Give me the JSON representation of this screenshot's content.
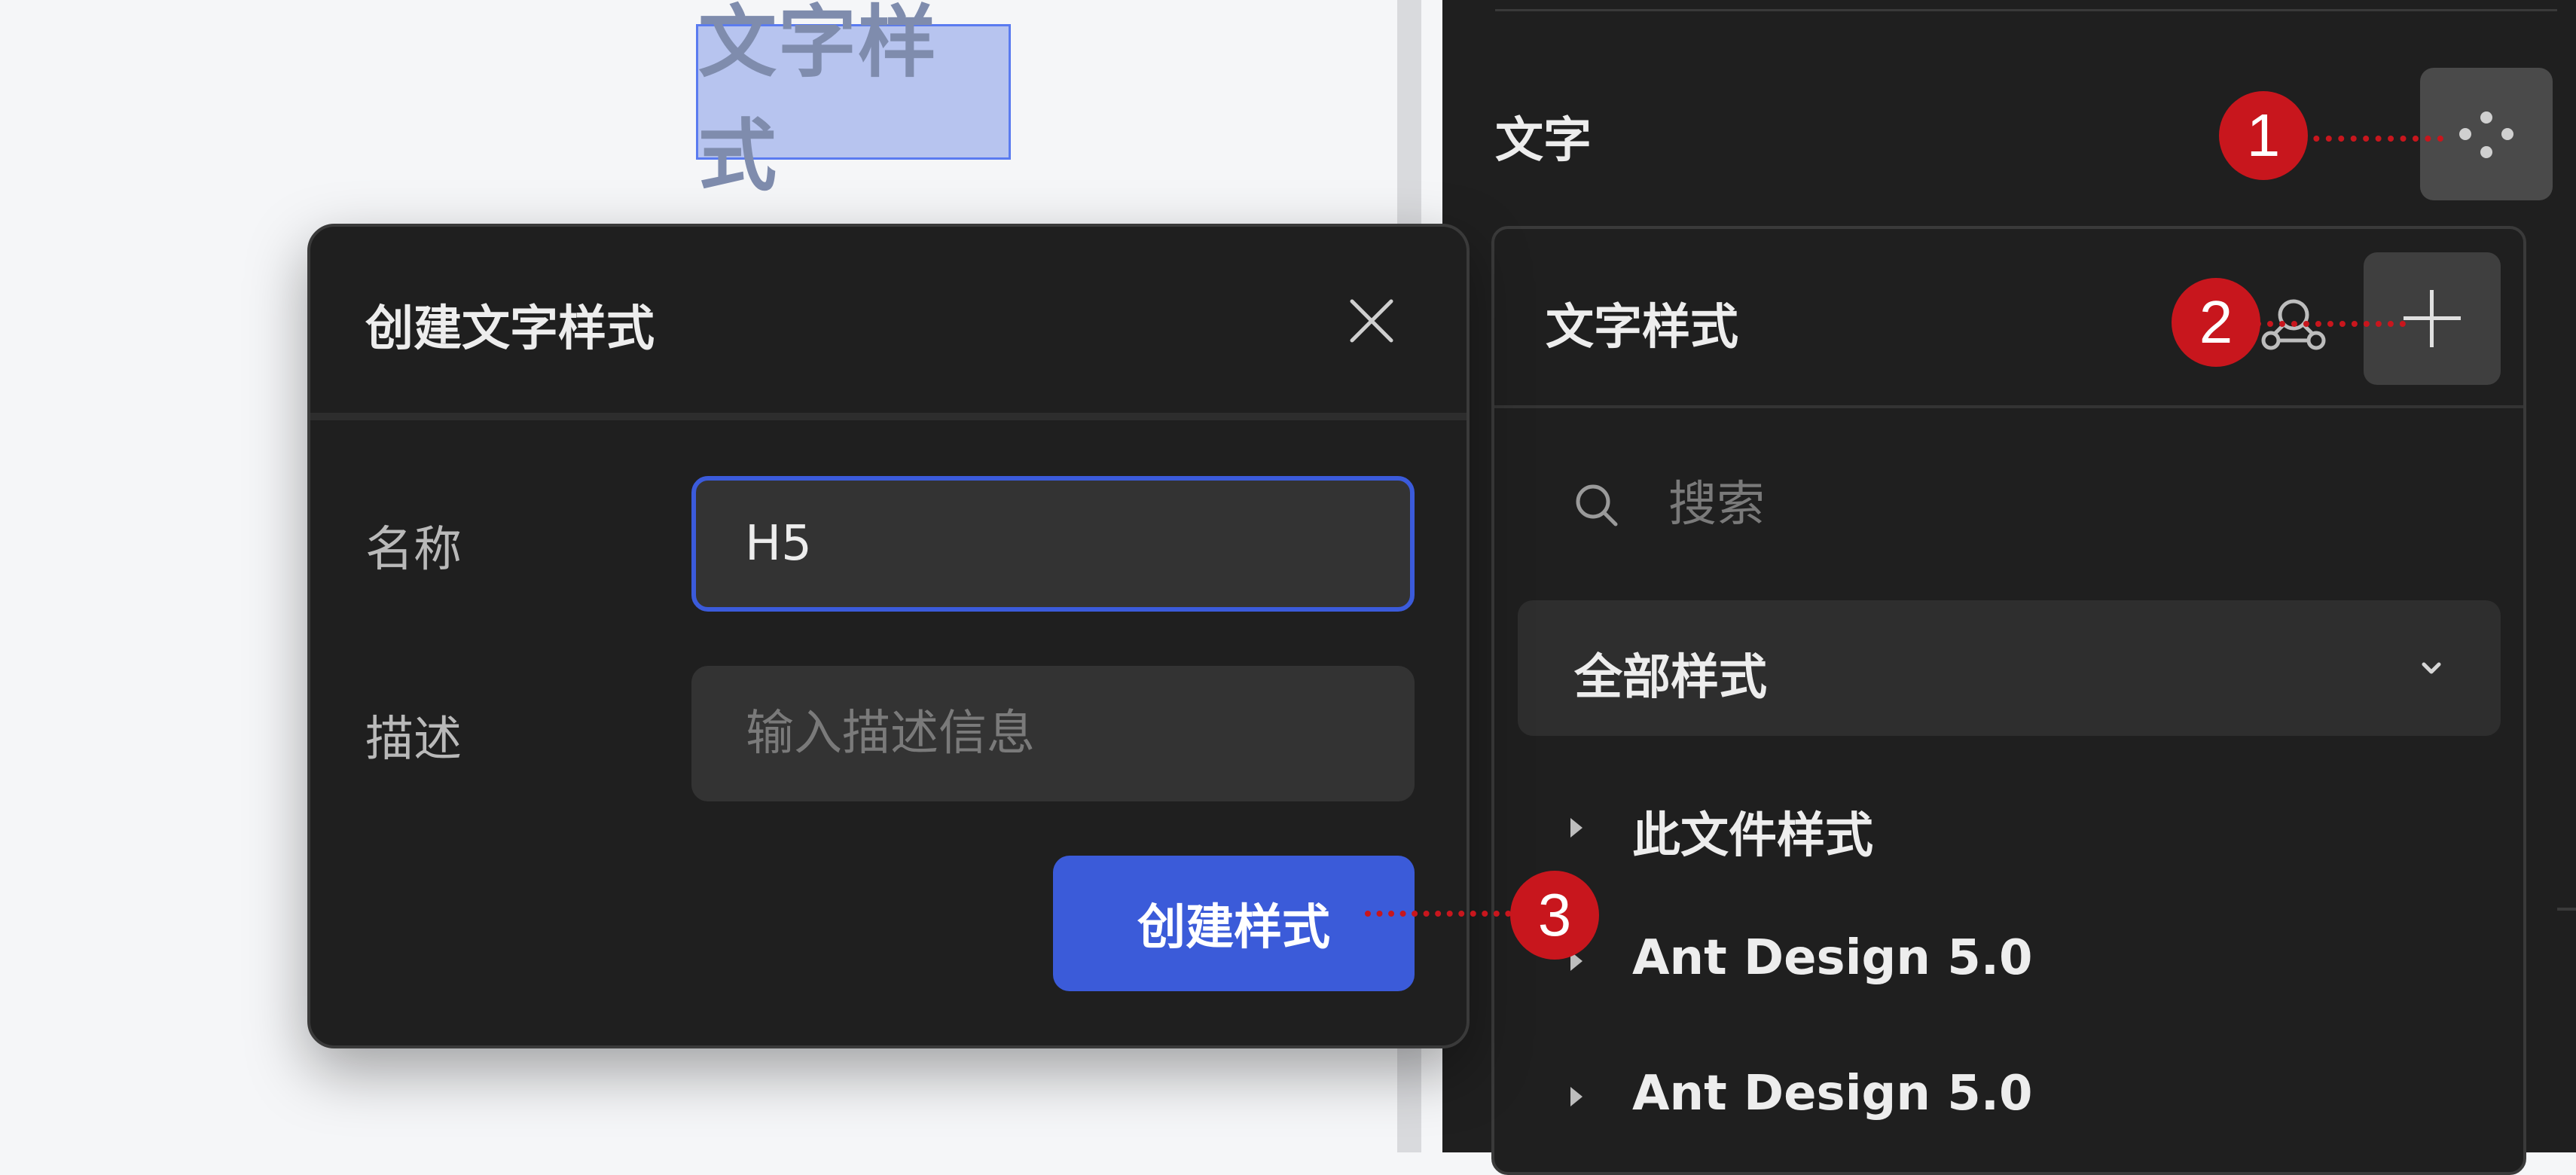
{
  "canvas": {
    "selected_text": "文字样式"
  },
  "panel": {
    "section_title": "文字",
    "style_icon": "four-dots-style-icon"
  },
  "styles_panel": {
    "title": "文字样式",
    "publish_icon": "team-library-icon",
    "add_icon": "plus-icon",
    "search": {
      "placeholder": "搜索",
      "value": ""
    },
    "filter": {
      "selected": "全部样式"
    },
    "groups": [
      {
        "label": "此文件样式"
      },
      {
        "label": "Ant Design 5.0"
      },
      {
        "label": "Ant Design 5.0"
      }
    ]
  },
  "modal": {
    "title": "创建文字样式",
    "close_icon": "close-icon",
    "name_label": "名称",
    "name_value": "H5",
    "desc_label": "描述",
    "desc_placeholder": "输入描述信息",
    "create_label": "创建样式"
  },
  "annotations": [
    {
      "number": "1"
    },
    {
      "number": "2"
    },
    {
      "number": "3"
    }
  ],
  "colors": {
    "panel_bg": "#1f1f1f",
    "accent": "#3b5bd9",
    "callout": "#c8161d",
    "selection": "#5a7bf0"
  }
}
